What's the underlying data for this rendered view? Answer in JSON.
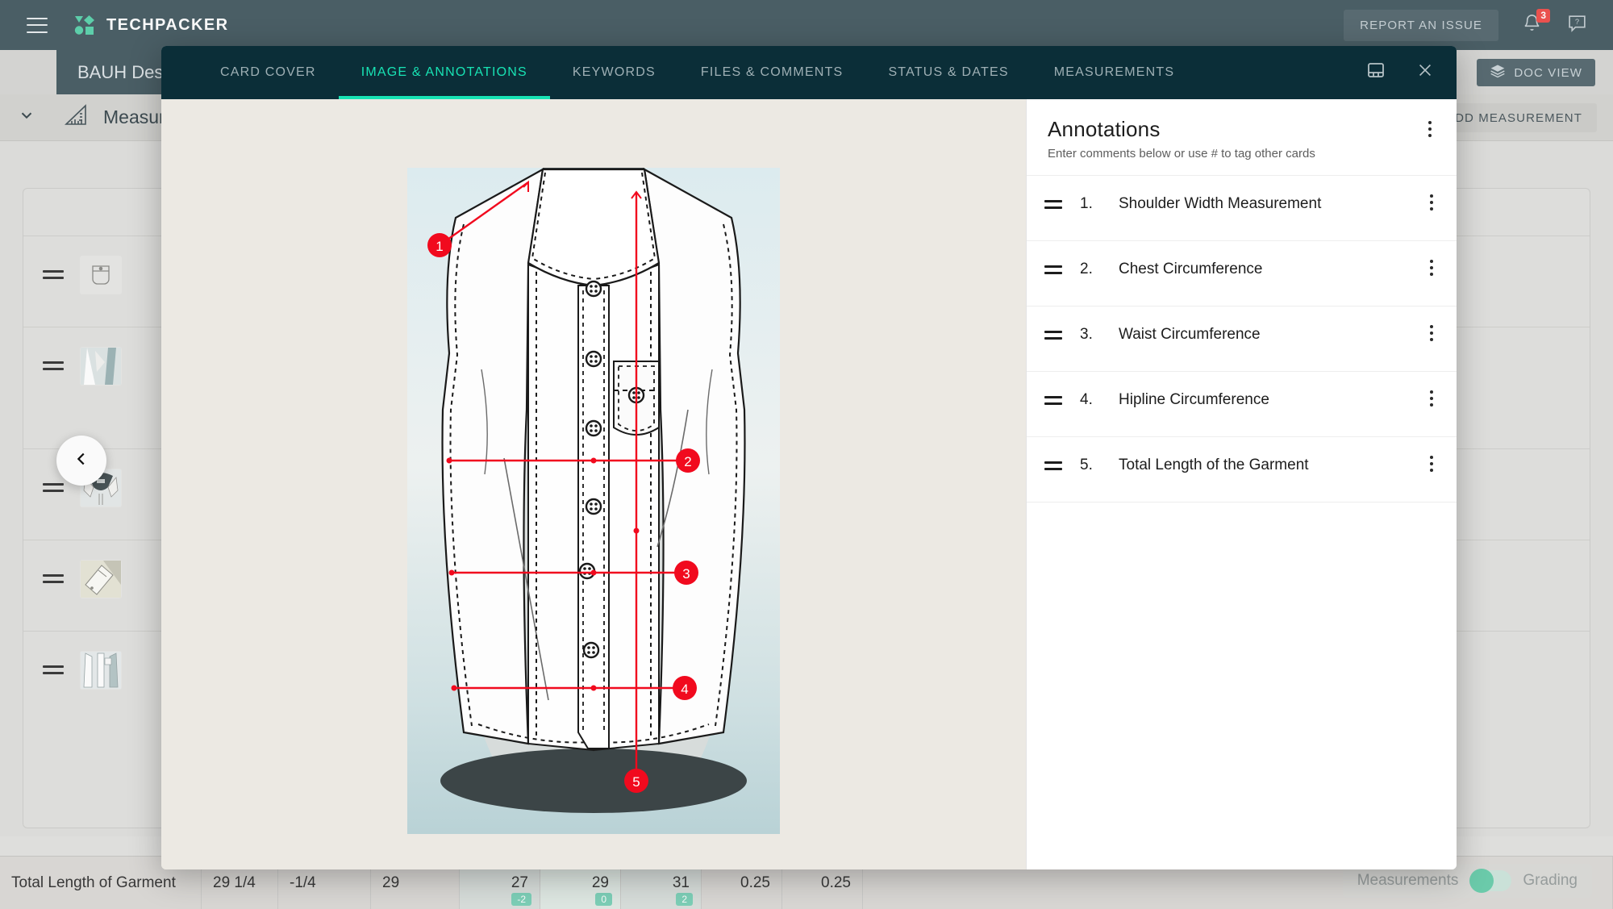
{
  "app": {
    "brand": "TECHPACKER",
    "menu_icon": "hamburger-icon",
    "report_issue_label": "REPORT AN ISSUE",
    "notification_count": "3",
    "notification_icon": "bell-icon",
    "help_icon": "help-icon",
    "accent_color": "#18e3b4",
    "topbar_color": "#4c6068"
  },
  "page": {
    "doc_tab_label": "BAUH Des",
    "doc_view_label": "DOC VIEW",
    "doc_view_icon": "layers-icon",
    "section_title": "Measur",
    "section_icon": "ruler-triangle-icon",
    "add_measurement_label": "ADD MEASUREMENT",
    "collapse_icon": "chevron-down-icon",
    "back_icon": "chevron-left-icon",
    "rows": [
      {
        "thumb": "pocket-thumb"
      },
      {
        "thumb": "placket-detail-thumb"
      },
      {
        "thumb": "collar-thumb"
      },
      {
        "thumb": "cuff-sketch-thumb"
      },
      {
        "thumb": "shirt-front-thumb"
      }
    ]
  },
  "bottom_table": {
    "row": {
      "name": "Total Length of Garment",
      "spec": "29 1/4",
      "tolerance": "-1/4",
      "base": "29",
      "sizes": [
        {
          "value": "27",
          "grade": "-2"
        },
        {
          "value": "29",
          "grade": "0"
        },
        {
          "value": "31",
          "grade": "2"
        }
      ],
      "extra": [
        "0.25",
        "0.25"
      ]
    },
    "toggle": {
      "left_label": "Measurements",
      "right_label": "Grading",
      "state": "left"
    }
  },
  "modal": {
    "tabs": [
      {
        "label": "CARD COVER",
        "active": false
      },
      {
        "label": "IMAGE & ANNOTATIONS",
        "active": true
      },
      {
        "label": "KEYWORDS",
        "active": false
      },
      {
        "label": "FILES & COMMENTS",
        "active": false
      },
      {
        "label": "STATUS & DATES",
        "active": false
      },
      {
        "label": "MEASUREMENTS",
        "active": false
      }
    ],
    "actions": {
      "layout_icon": "layout-panel-icon",
      "close_icon": "close-icon"
    },
    "annotations": {
      "title": "Annotations",
      "subtitle": "Enter comments below or use # to tag other cards",
      "menu_icon": "kebab-menu-icon",
      "items": [
        {
          "number": "1.",
          "text": "Shoulder Width Measurement"
        },
        {
          "number": "2.",
          "text": "Chest Circumference"
        },
        {
          "number": "3.",
          "text": "Waist Circumference"
        },
        {
          "number": "4.",
          "text": "Hipline Circumference"
        },
        {
          "number": "5.",
          "text": "Total Length of the Garment"
        }
      ]
    },
    "artwork": {
      "description": "technical flat sketch of a short-sleeve button-down shirt with red measurement annotation lines",
      "marker_color": "#f10a1e",
      "markers": [
        "1",
        "2",
        "3",
        "4",
        "5"
      ]
    }
  }
}
